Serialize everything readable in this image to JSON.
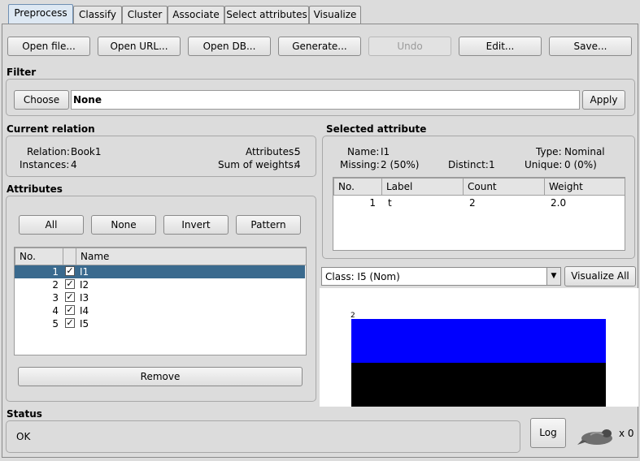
{
  "tabs": [
    "Preprocess",
    "Classify",
    "Cluster",
    "Associate",
    "Select attributes",
    "Visualize"
  ],
  "toolbar": {
    "open_file": "Open file...",
    "open_url": "Open URL...",
    "open_db": "Open DB...",
    "generate": "Generate...",
    "undo": "Undo",
    "edit": "Edit...",
    "save": "Save..."
  },
  "filter": {
    "title": "Filter",
    "choose": "Choose",
    "value": "None",
    "apply": "Apply"
  },
  "current_relation": {
    "title": "Current relation",
    "relation_label": "Relation:",
    "relation_value": "Book1",
    "instances_label": "Instances:",
    "instances_value": "4",
    "attributes_label": "Attributes:",
    "attributes_value": "5",
    "weights_label": "Sum of weights:",
    "weights_value": "4"
  },
  "attributes": {
    "title": "Attributes",
    "buttons": {
      "all": "All",
      "none": "None",
      "invert": "Invert",
      "pattern": "Pattern"
    },
    "col_no": "No.",
    "col_name": "Name",
    "rows": [
      {
        "no": "1",
        "name": "I1",
        "checked": true
      },
      {
        "no": "2",
        "name": "I2",
        "checked": true
      },
      {
        "no": "3",
        "name": "I3",
        "checked": true
      },
      {
        "no": "4",
        "name": "I4",
        "checked": true
      },
      {
        "no": "5",
        "name": "I5",
        "checked": true
      }
    ],
    "remove": "Remove"
  },
  "selected_attribute": {
    "title": "Selected attribute",
    "name_label": "Name:",
    "name_value": "I1",
    "type_label": "Type:",
    "type_value": "Nominal",
    "missing_label": "Missing:",
    "missing_value": "2 (50%)",
    "distinct_label": "Distinct:",
    "distinct_value": "1",
    "unique_label": "Unique:",
    "unique_value": "0 (0%)",
    "columns": [
      "No.",
      "Label",
      "Count",
      "Weight"
    ],
    "rows": [
      {
        "no": "1",
        "label": "t",
        "count": "2",
        "weight": "2.0"
      }
    ]
  },
  "class_select": {
    "value": "Class: I5 (Nom)",
    "visualize_all": "Visualize All"
  },
  "chart_data": {
    "type": "bar",
    "categories": [
      "t"
    ],
    "values": [
      2
    ],
    "top_label": "2",
    "colors": [
      "#0000ff",
      "#000000"
    ]
  },
  "status": {
    "title": "Status",
    "text": "OK",
    "log": "Log",
    "count": "x 0"
  }
}
